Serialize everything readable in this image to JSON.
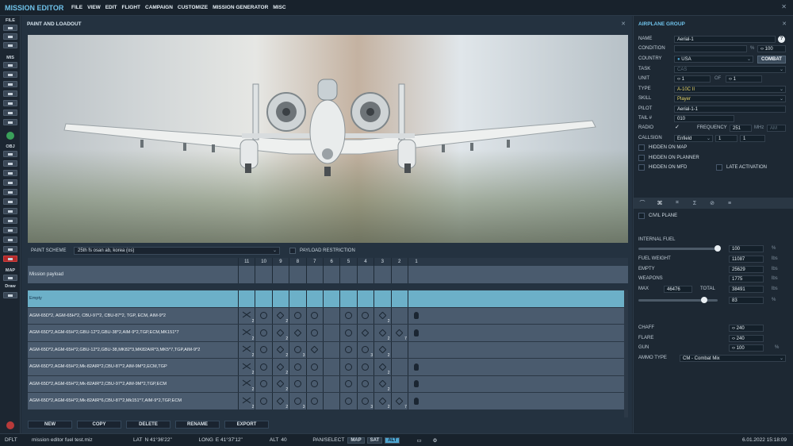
{
  "app": {
    "title": "MISSION EDITOR"
  },
  "menu": [
    "FILE",
    "VIEW",
    "EDIT",
    "FLIGHT",
    "CAMPAIGN",
    "CUSTOMIZE",
    "MISSION GENERATOR",
    "MISC"
  ],
  "toolbar": {
    "file_label": "FILE",
    "mis_label": "MIS",
    "obj_label": "OBJ",
    "map_label": "MAP",
    "draw_label": "Draw"
  },
  "paint_panel": {
    "title": "PAINT AND LOADOUT",
    "scheme_label": "PAINT SCHEME",
    "scheme_value": "25th fs osan ab, korea (os)",
    "restriction_label": "PAYLOAD RESTRICTION"
  },
  "loadout": {
    "stations": [
      "11",
      "10",
      "9",
      "8",
      "7",
      "6",
      "5",
      "4",
      "3",
      "2",
      "1"
    ],
    "mission_payload_label": "Mission payload",
    "rows": [
      {
        "name": "Empty",
        "selected": true,
        "cells": [
          "",
          "",
          "",
          "",
          "",
          "",
          "",
          "",
          "",
          "",
          ""
        ],
        "counts": [
          "",
          "",
          "",
          "",
          "",
          "",
          "",
          "",
          "",
          "",
          ""
        ]
      },
      {
        "name": "AGM-65D*2, AGM-65H*2, CBU-97*2, CBU-87*2, TGP, ECM, AIM-9*2",
        "selected": false,
        "cells": [
          "x",
          "o",
          "s",
          "o",
          "o",
          "",
          "o",
          "o",
          "s",
          "",
          "b"
        ],
        "counts": [
          "2",
          "",
          "2",
          "",
          "",
          "",
          "",
          "",
          "2",
          "",
          ""
        ]
      },
      {
        "name": "AGM-65D*2,AGM-65H*2,GBU-12*2,GBU-38*2,AIM-9*2,TGP,ECM,MK151*7",
        "selected": false,
        "cells": [
          "x",
          "o",
          "s",
          "s",
          "o",
          "",
          "o",
          "s",
          "s",
          "s",
          "b"
        ],
        "counts": [
          "2",
          "",
          "2",
          "",
          "",
          "",
          "",
          "",
          "2",
          "7",
          ""
        ]
      },
      {
        "name": "AGM-65D*2,AGM-65H*2,GBU-12*2,GBU-38,MK82*3,MK82AIR*3,MK5*7,TGP,AIM-9*2",
        "selected": false,
        "cells": [
          "x",
          "o",
          "s",
          "o",
          "s",
          "",
          "o",
          "o",
          "s",
          "",
          ""
        ],
        "counts": [
          "2",
          "",
          "2",
          "3",
          "",
          "",
          "",
          "3",
          "2",
          "",
          ""
        ]
      },
      {
        "name": "AGM-65D*2,AGM-65H*2,Mk-82AIR*2,CBU-87*2,AIM-9M*2,ECM,TGP",
        "selected": false,
        "cells": [
          "x",
          "o",
          "s",
          "o",
          "o",
          "",
          "o",
          "o",
          "s",
          "",
          "b"
        ],
        "counts": [
          "2",
          "",
          "2",
          "",
          "",
          "",
          "",
          "",
          "2",
          "",
          ""
        ]
      },
      {
        "name": "AGM-65D*2,AGM-65H*2,Mk-82AIR*2,CBU-97*2,AIM-9M*2,TGP,ECM",
        "selected": false,
        "cells": [
          "x",
          "o",
          "s",
          "o",
          "o",
          "",
          "o",
          "o",
          "s",
          "",
          "b"
        ],
        "counts": [
          "2",
          "",
          "2",
          "",
          "",
          "",
          "",
          "",
          "2",
          "",
          ""
        ]
      },
      {
        "name": "AGM-65D*2,AGM-65H*2,Mk-82AIR*6,CBU-87*2,Mk151*7,AIM-9*2,TGP,ECM",
        "selected": false,
        "cells": [
          "x",
          "o",
          "s",
          "o",
          "o",
          "",
          "o",
          "o",
          "s",
          "s",
          "b"
        ],
        "counts": [
          "2",
          "",
          "2",
          "3",
          "",
          "",
          "",
          "3",
          "2",
          "7",
          ""
        ]
      }
    ]
  },
  "buttons": {
    "new": "NEW",
    "copy": "COPY",
    "delete": "DELETE",
    "rename": "RENAME",
    "export": "EXPORT"
  },
  "airplane_group": {
    "title": "AIRPLANE GROUP",
    "help": "?",
    "name_label": "NAME",
    "name_value": "Aerial-1",
    "condition_label": "CONDITION",
    "condition_unit": "%",
    "condition_value": "100",
    "country_label": "COUNTRY",
    "country_value": "USA",
    "combat_label": "COMBAT",
    "task_label": "TASK",
    "task_value": "CAS",
    "unit_label": "UNIT",
    "unit_value": "1",
    "of_label": "OF",
    "of_value": "1",
    "type_label": "TYPE",
    "type_value": "A-10C II",
    "skill_label": "SKILL",
    "skill_value": "Player",
    "pilot_label": "PILOT",
    "pilot_value": "Aerial-1-1",
    "tail_label": "TAIL #",
    "tail_value": "010",
    "radio_label": "RADIO",
    "frequency_label": "FREQUENCY",
    "frequency_value": "251",
    "frequency_unit": "MHz",
    "modulation": "AM",
    "callsign_label": "CALLSIGN",
    "callsign_value": "Enfield",
    "callsign_n1": "1",
    "callsign_n2": "1",
    "hidden_map": "HIDDEN ON MAP",
    "hidden_planner": "HIDDEN ON PLANNER",
    "hidden_mfd": "HIDDEN ON MFD",
    "late_activation": "LATE ACTIVATION"
  },
  "payload": {
    "civil_plane": "CIVIL PLANE",
    "internal_fuel_label": "INTERNAL FUEL",
    "internal_fuel_value": "100",
    "internal_fuel_unit": "%",
    "internal_fuel_level": 1.0,
    "fuel_weight_label": "FUEL WEIGHT",
    "fuel_weight_value": "11087",
    "fuel_weight_unit": "lbs",
    "empty_label": "EMPTY",
    "empty_value": "25629",
    "empty_unit": "lbs",
    "weapons_label": "WEAPONS",
    "weapons_value": "1775",
    "weapons_unit": "lbs",
    "max_label": "MAX",
    "max_value": "46476",
    "total_label": "TOTAL",
    "total_value": "38491",
    "total_unit": "lbs",
    "weight_percent_value": "83",
    "weight_percent_unit": "%",
    "weight_level": 0.83,
    "chaff_label": "CHAFF",
    "chaff_value": "240",
    "flare_label": "FLARE",
    "flare_value": "240",
    "gun_label": "GUN",
    "gun_value": "100",
    "gun_unit": "%",
    "ammo_label": "AMMO TYPE",
    "ammo_value": "CM - Combat Mix"
  },
  "status": {
    "mode": "DFLT",
    "file": "mission editor fuel test.miz",
    "lat_label": "LAT",
    "lat_value": "N 41°36'22\"",
    "long_label": "LONG",
    "long_value": "E 41°37'12\"",
    "alt_label": "ALT",
    "alt_value": "40",
    "pan_label": "PAN/SELECT",
    "map_tag": "MAP",
    "sat_tag": "SAT",
    "alt_tag": "ALT",
    "datetime": "6.01.2022 15:18:09"
  },
  "colors": {
    "accent": "#6fc2ea",
    "selected_row": "#6cb0c8",
    "panel": "#243240"
  }
}
